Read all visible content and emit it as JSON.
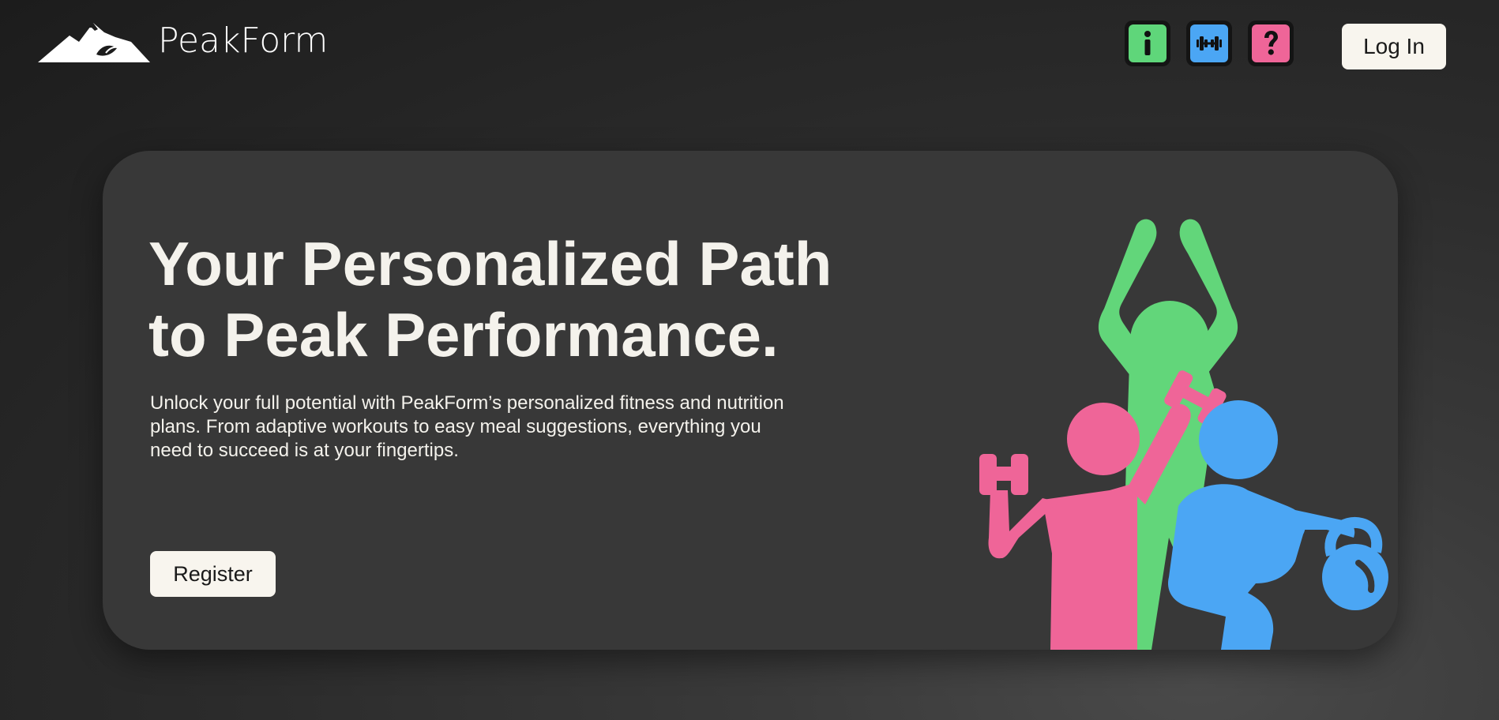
{
  "header": {
    "brand_name": "PeakForm",
    "nav_icons": [
      {
        "name": "info-icon",
        "color": "#5fd67a"
      },
      {
        "name": "dumbbell-icon",
        "color": "#4ba6f4"
      },
      {
        "name": "question-mark-icon",
        "color": "#ef6598"
      }
    ],
    "login_label": "Log In"
  },
  "hero": {
    "title_line1": "Your Personalized Path",
    "title_line2": "to Peak Performance.",
    "description": "Unlock your full potential with PeakForm’s personalized fitness and nutrition plans. From adaptive workouts to easy meal suggestions, everything you need to succeed is at your fingertips.",
    "register_label": "Register",
    "illustration": "fitness-people-illustration"
  },
  "colors": {
    "accent_green": "#5fd67a",
    "accent_blue": "#4ba6f4",
    "accent_pink": "#ef6598",
    "button_bg": "#f8f5ee",
    "card_bg": "#383838"
  }
}
